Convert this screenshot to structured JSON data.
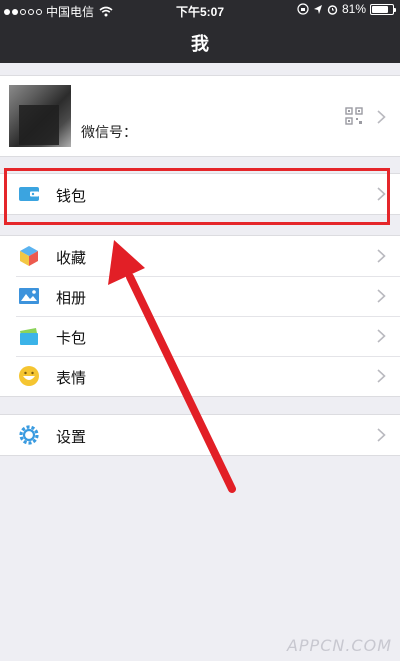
{
  "status_bar": {
    "carrier": "中国电信",
    "time": "下午5:07",
    "battery": "81%",
    "battery_level": 0.81
  },
  "nav": {
    "title": "我"
  },
  "profile": {
    "wechat_id_label": "微信号："
  },
  "menu": {
    "wallet": "钱包",
    "favorites": "收藏",
    "album": "相册",
    "cards": "卡包",
    "stickers": "表情",
    "settings": "设置"
  },
  "colors": {
    "topbar": "#2b2b2f",
    "highlight": "#e5262a",
    "background": "#eeeef3"
  },
  "icons": [
    "wifi-icon",
    "lock-rotation-icon",
    "location-icon",
    "alarm-icon",
    "battery-icon",
    "qr-code-icon",
    "wallet-icon",
    "favorites-icon",
    "album-icon",
    "card-icon",
    "sticker-icon",
    "settings-icon",
    "chevron-right-icon"
  ],
  "watermark": "APPCN.COM"
}
